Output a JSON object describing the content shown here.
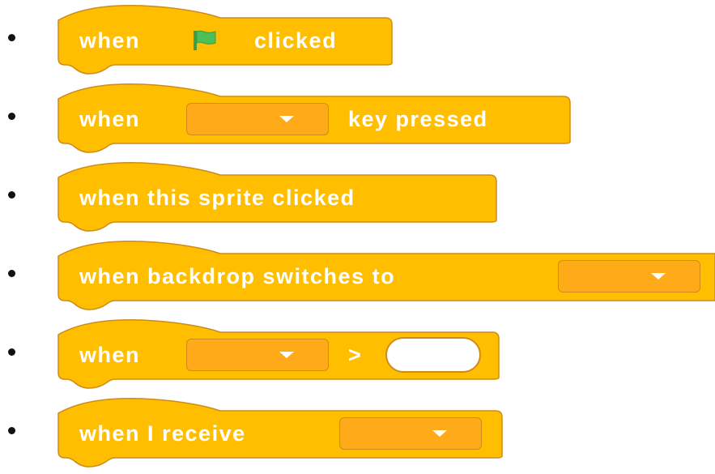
{
  "colors": {
    "block_fill": "#ffbf00",
    "block_stroke": "#cf8b17",
    "flag": "#4cbf56"
  },
  "blocks": [
    {
      "parts": [
        "when",
        "clicked"
      ],
      "icon": "green-flag-icon"
    },
    {
      "parts": [
        "when",
        "key pressed"
      ]
    },
    {
      "parts": [
        "when this sprite clicked"
      ]
    },
    {
      "parts": [
        "when backdrop switches to"
      ]
    },
    {
      "parts": [
        "when",
        ">"
      ]
    },
    {
      "parts": [
        "when I receive"
      ]
    }
  ]
}
